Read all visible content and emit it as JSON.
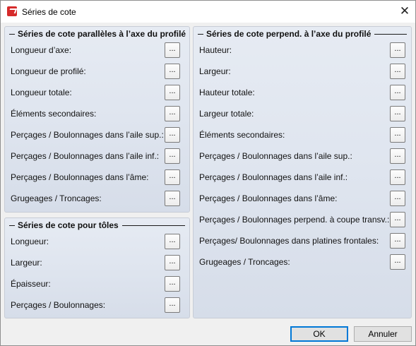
{
  "window": {
    "title": "Séries de cote",
    "close_glyph": "✕"
  },
  "left_top": {
    "header": "Séries de cote parallèles à l’axe du profilé",
    "items": [
      "Longueur d’axe:",
      "Longueur de profilé:",
      "Longueur totale:",
      "Éléments secondaires:",
      "Perçages / Boulonnages dans l’aile sup.:",
      "Perçages / Boulonnages dans l’aile inf.:",
      "Perçages / Boulonnages dans l’âme:",
      "Grugeages / Troncages:"
    ]
  },
  "left_bottom": {
    "header": "Séries de cote pour tôles",
    "items": [
      "Longueur:",
      "Largeur:",
      "Épaisseur:",
      "Perçages / Boulonnages:"
    ]
  },
  "right": {
    "header": "Séries de cote perpend. à l’axe du profilé",
    "items": [
      "Hauteur:",
      "Largeur:",
      "Hauteur totale:",
      "Largeur totale:",
      "Éléments secondaires:",
      "Perçages / Boulonnages dans l’aile sup.:",
      "Perçages / Boulonnages dans l’aile inf.:",
      "Perçages / Boulonnages dans l’âme:",
      "Perçages / Boulonnages perpend. à coupe transv.:",
      "Perçages/ Boulonnages dans platines frontales:",
      "Grugeages / Troncages:"
    ]
  },
  "browse_label": "...",
  "footer": {
    "ok_label": "OK",
    "cancel_label": "Annuler"
  }
}
